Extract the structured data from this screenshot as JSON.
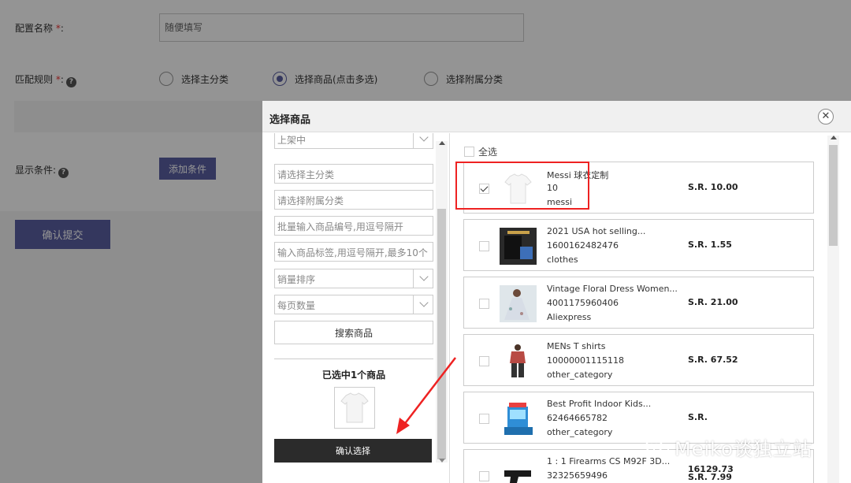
{
  "background_form": {
    "config_name_label": "配置名称",
    "required_mark": "*",
    "colon": ":",
    "config_name_placeholder": "随便填写",
    "match_rule_label": "匹配规则",
    "radio_options": [
      "选择主分类",
      "选择商品(点击多选)",
      "选择附属分类"
    ],
    "selected_radio": 1,
    "display_condition_label": "显示条件:",
    "add_condition_button": "添加条件",
    "submit_button": "确认提交"
  },
  "modal": {
    "title": "选择商品",
    "close_icon": "close-icon",
    "filters": {
      "status_select": "上架中",
      "main_category_placeholder": "请选择主分类",
      "sub_category_placeholder": "请选择附属分类",
      "batch_ids_placeholder": "批量输入商品编号,用逗号隔开",
      "tags_placeholder": "输入商品标签,用逗号隔开,最多10个",
      "sort_select": "销量排序",
      "page_size_select": "每页数量",
      "search_button": "搜索商品"
    },
    "selected_summary": "已选中1个商品",
    "confirm_button": "确认选择",
    "select_all_label": "全选",
    "products": [
      {
        "name": "Messi 球衣定制",
        "id": "10",
        "category": "messi",
        "price": "S.R. 10.00",
        "checked": true
      },
      {
        "name": "2021 USA hot selling...",
        "id": "1600162482476",
        "category": "clothes",
        "price": "S.R. 1.55",
        "checked": false
      },
      {
        "name": "Vintage Floral Dress Women...",
        "id": "4001175960406",
        "category": "Aliexpress",
        "price": "S.R. 21.00",
        "checked": false
      },
      {
        "name": "MENs T shirts",
        "id": "10000001115118",
        "category": "other_category",
        "price": "S.R. 67.52",
        "checked": false
      },
      {
        "name": "Best Profit Indoor Kids...",
        "id": "62464665782",
        "category": "other_category",
        "price": "S.R.",
        "checked": false
      },
      {
        "name": "1 : 1 Firearms CS M92F 3D...",
        "id": "32325659496",
        "category": "",
        "price": "16129.73",
        "price2": "S.R. 7.99",
        "checked": false
      }
    ],
    "annotation_color": "#e22222"
  },
  "watermark": {
    "text": "Meiko谈独立站",
    "icon": "wechat-icon"
  },
  "colors": {
    "primary": "#5b5fa3",
    "dark_button": "#2b2b2b",
    "overlay": "rgba(0,0,0,0.42)"
  }
}
